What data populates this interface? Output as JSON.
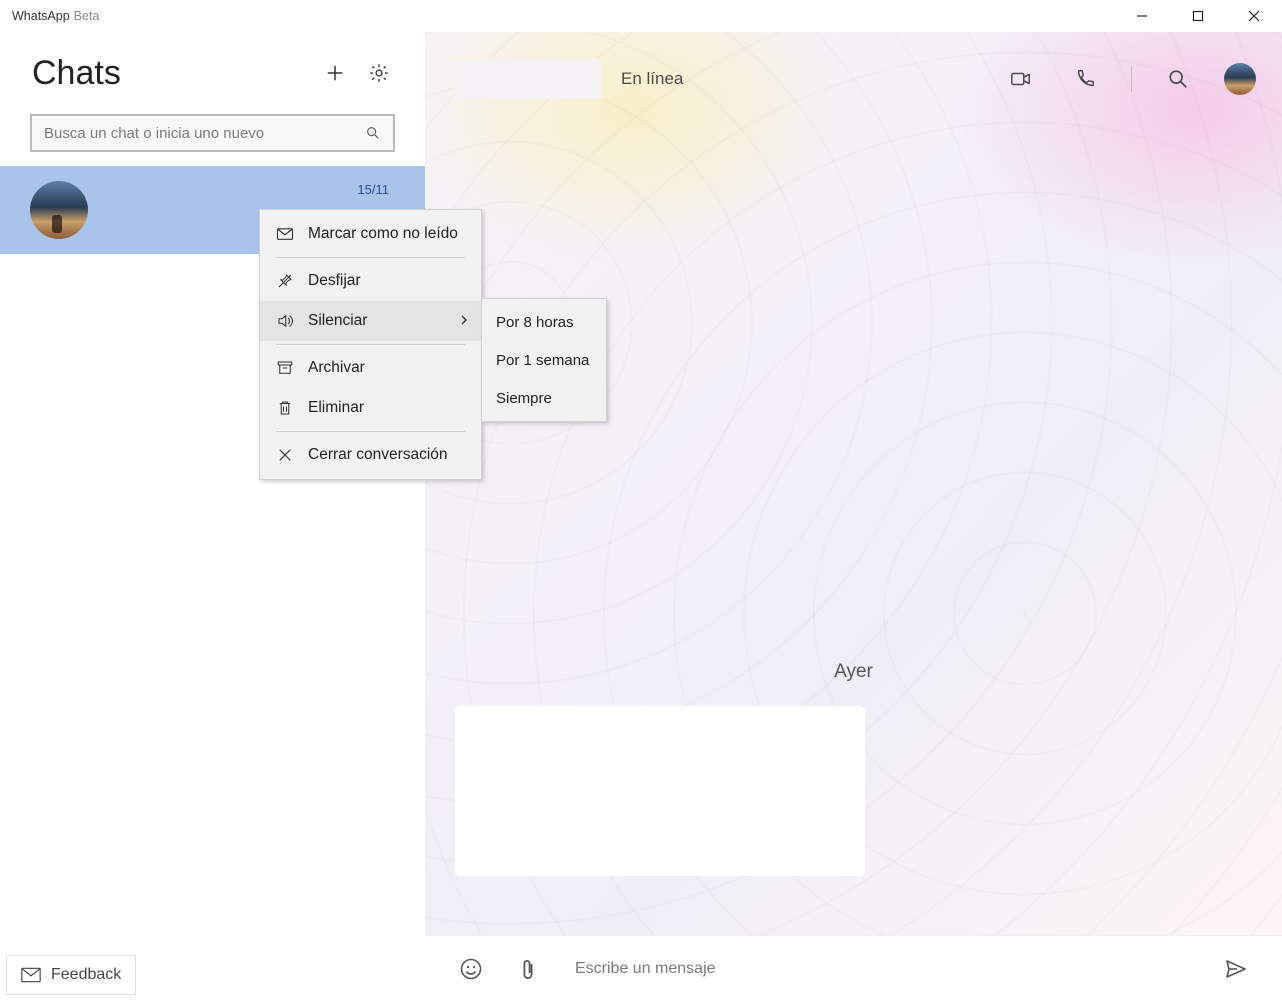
{
  "window": {
    "app_name": "WhatsApp",
    "app_suffix": "Beta"
  },
  "sidebar": {
    "title": "Chats",
    "search_placeholder": "Busca un chat o inicia uno nuevo",
    "feedback_label": "Feedback",
    "chat_date": "15/11"
  },
  "chat": {
    "status": "En línea",
    "date_label": "Ayer",
    "composer_placeholder": "Escribe un mensaje"
  },
  "context_menu": {
    "mark_unread": "Marcar como no leído",
    "unpin": "Desfijar",
    "mute": "Silenciar",
    "archive": "Archivar",
    "delete": "Eliminar",
    "close": "Cerrar conversación"
  },
  "mute_submenu": {
    "eight_hours": "Por 8 horas",
    "one_week": "Por 1 semana",
    "always": "Siempre"
  }
}
